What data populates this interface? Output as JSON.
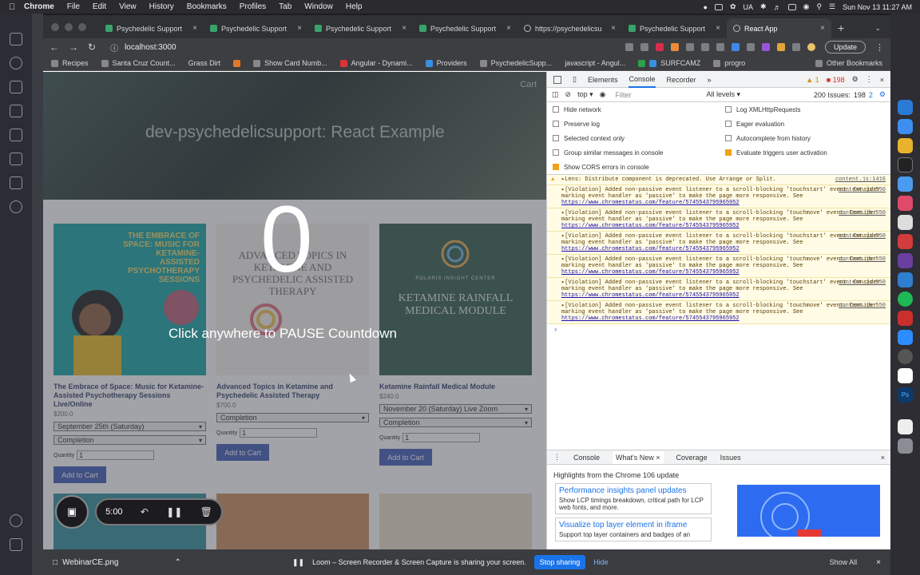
{
  "menubar": {
    "app": "Chrome",
    "items": [
      "File",
      "Edit",
      "View",
      "History",
      "Bookmarks",
      "Profiles",
      "Tab",
      "Window",
      "Help"
    ],
    "input_source": "UA",
    "datetime": "Sun Nov 13  11:27 AM"
  },
  "browser": {
    "tabs": [
      {
        "label": "Psychedelic Support"
      },
      {
        "label": "Psychedelic Support"
      },
      {
        "label": "Psychedelic Support"
      },
      {
        "label": "Psychedelic Support"
      },
      {
        "label": "https://psychedelicsu"
      },
      {
        "label": "Psychedelic Support"
      },
      {
        "label": "React App"
      }
    ],
    "address": "localhost:3000",
    "update_label": "Update",
    "bookmarks": [
      "Recipes",
      "Santa Cruz Count...",
      "Grass Dirt",
      "Show Card Numb...",
      "Angular - Dynami...",
      "Providers",
      "PsychedelicSupp...",
      "javascript - Angul...",
      "SURFCAMZ",
      "progro"
    ],
    "other_bookmarks": "Other Bookmarks"
  },
  "page": {
    "hero_title": "dev-psychedelicsupport: React Example",
    "cart_label": "Cart",
    "products": [
      {
        "name": "The Embrace of Space: Music for Ketamine-Assisted Psychotherapy Sessions Live/Online",
        "price": "$200.0",
        "image_text": "THE EMBRACE OF SPACE: MUSIC FOR KETAMINE-ASSISTED PSYCHOTHERAPY SESSIONS",
        "option1": "September 25th (Saturday)",
        "option2": "Completion",
        "quantity_label": "Quantity",
        "quantity": "1",
        "button": "Add to Cart"
      },
      {
        "name": "Advanced Topics in Ketamine and Psychedelic Assisted Therapy",
        "price": "$700.0",
        "image_text": "ADVANCED TOPICS IN KETAMINE AND PSYCHEDELIC ASSISTED THERAPY",
        "option1": "Completion",
        "quantity_label": "Quantity",
        "quantity": "1",
        "button": "Add to Cart"
      },
      {
        "name": "Ketamine Rainfall Medical Module",
        "price": "$240.0",
        "image_text": "KETAMINE RAINFALL MEDICAL MODULE",
        "image_sub": "POLARIS INSIGHT CENTER",
        "option1": "November 20 (Saturday) Live Zoom",
        "option2": "Completion",
        "quantity_label": "Quantity",
        "quantity": "1",
        "button": "Add to Cart"
      }
    ]
  },
  "overlay": {
    "countdown": "0",
    "message": "Click anywhere to PAUSE Countdown"
  },
  "loom": {
    "timer": "5:00",
    "share_message": "Loom – Screen Recorder & Screen Capture is sharing your screen.",
    "stop_label": "Stop sharing",
    "hide_label": "Hide"
  },
  "devtools": {
    "tabs": [
      "Elements",
      "Console",
      "Recorder"
    ],
    "active_tab": "Console",
    "warn_count": "1",
    "error_count": "198",
    "context": "top",
    "filter_placeholder": "Filter",
    "levels": "All levels",
    "issues_label": "200 Issues:",
    "issues_errors": "198",
    "issues_info": "2",
    "settings": [
      {
        "label": "Hide network",
        "checked": false
      },
      {
        "label": "Log XMLHttpRequests",
        "checked": false
      },
      {
        "label": "Preserve log",
        "checked": false
      },
      {
        "label": "Eager evaluation",
        "checked": false
      },
      {
        "label": "Selected context only",
        "checked": false
      },
      {
        "label": "Autocomplete from history",
        "checked": false
      },
      {
        "label": "Group similar messages in console",
        "checked": false
      },
      {
        "label": "Evaluate triggers user activation",
        "checked": true
      },
      {
        "label": "Show CORS errors in console",
        "checked": true
      }
    ],
    "logs": [
      {
        "text": "▸Lens: Distribute component is deprecated. Use Arrange or Split.",
        "source": "content.js:1416",
        "link": ""
      },
      {
        "text": "▸[Violation] Added non-passive event listener to a scroll-blocking 'touchstart' event. Consider marking event handler as 'passive' to make the page more responsive. See",
        "source": "content.js:550",
        "link": "https://www.chromestatus.com/feature/5745543795965952"
      },
      {
        "text": "▸[Violation] Added non-passive event listener to a scroll-blocking 'touchmove' event. Consider marking event handler as 'passive' to make the page more responsive. See",
        "source": "content.js:550",
        "link": "https://www.chromestatus.com/feature/5745543795965952"
      },
      {
        "text": "▸[Violation] Added non-passive event listener to a scroll-blocking 'touchstart' event. Consider marking event handler as 'passive' to make the page more responsive. See",
        "source": "content.js:550",
        "link": "https://www.chromestatus.com/feature/5745543795965952"
      },
      {
        "text": "▸[Violation] Added non-passive event listener to a scroll-blocking 'touchmove' event. Consider marking event handler as 'passive' to make the page more responsive. See",
        "source": "content.js:550",
        "link": "https://www.chromestatus.com/feature/5745543795965952"
      },
      {
        "text": "▸[Violation] Added non-passive event listener to a scroll-blocking 'touchstart' event. Consider marking event handler as 'passive' to make the page more responsive. See",
        "source": "content.js:550",
        "link": "https://www.chromestatus.com/feature/5745543795965952"
      },
      {
        "text": "▸[Violation] Added non-passive event listener to a scroll-blocking 'touchmove' event. Consider marking event handler as 'passive' to make the page more responsive. See",
        "source": "content.js:550",
        "link": "https://www.chromestatus.com/feature/5745543795965952"
      }
    ],
    "drawer": {
      "tabs": [
        "Console",
        "What's New",
        "Coverage",
        "Issues"
      ],
      "headline": "Highlights from the Chrome 106 update",
      "features": [
        {
          "title": "Performance insights panel updates",
          "desc": "Show LCP timings breakdown, critical path for LCP web fonts, and more."
        },
        {
          "title": "Visualize top layer element in iframe",
          "desc": "Support top layer containers and badges of an"
        }
      ]
    }
  },
  "downloads": {
    "file": "WebinarCE.png",
    "show_all": "Show All"
  },
  "colors": {
    "accent_blue": "#1a73e8",
    "add_to_cart": "#3f5bb5",
    "warning_bg": "#fffbe5"
  }
}
